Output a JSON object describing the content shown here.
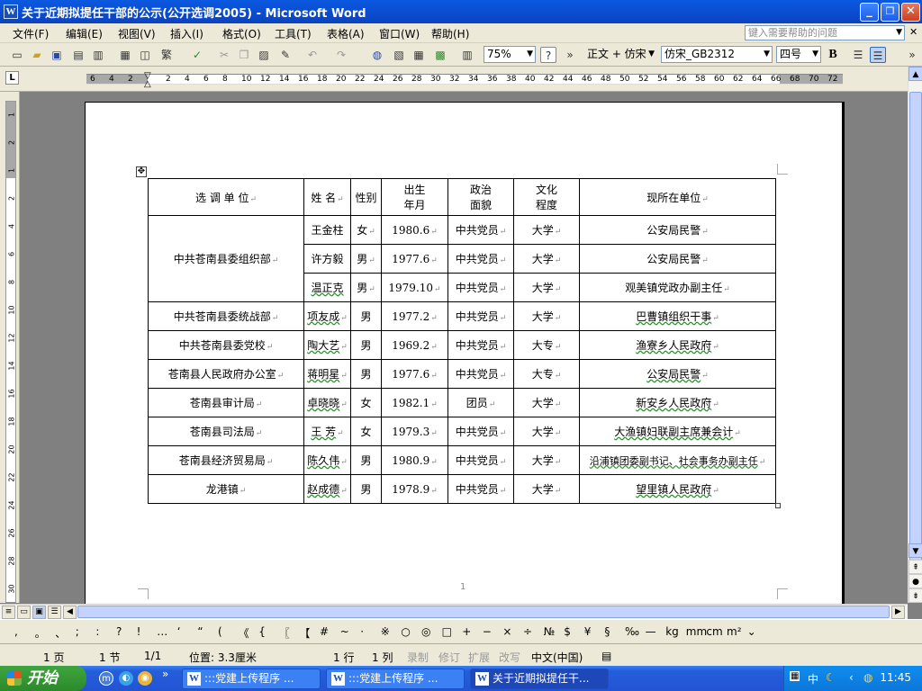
{
  "window": {
    "title": "关于近期拟提任干部的公示(公开选调2005) - Microsoft Word",
    "app_icon_letter": "W",
    "min_glyph": "_",
    "max_glyph": "❐",
    "close_glyph": "✕"
  },
  "menu": {
    "items": [
      "文件(F)",
      "编辑(E)",
      "视图(V)",
      "插入(I)",
      "格式(O)",
      "工具(T)",
      "表格(A)",
      "窗口(W)",
      "帮助(H)"
    ],
    "help_placeholder": "键入需要帮助的问题",
    "close_doc": "✕"
  },
  "toolbar": {
    "zoom": "75%",
    "style": "正文 + 仿宋",
    "font": "仿宋_GB2312",
    "size": "四号",
    "bold": "B",
    "trad_glyph": "繁"
  },
  "ruler": {
    "tab_selector": "L",
    "h_numbers": [
      "6",
      "4",
      "2",
      "",
      "2",
      "4",
      "6",
      "8",
      "10",
      "12",
      "14",
      "16",
      "18",
      "20",
      "22",
      "24",
      "26",
      "28",
      "30",
      "32",
      "34",
      "36",
      "38",
      "40",
      "42",
      "44",
      "46",
      "48",
      "50",
      "52",
      "54",
      "56",
      "58",
      "60",
      "62",
      "64",
      "66",
      "68",
      "70",
      "72"
    ],
    "v_numbers": [
      "1",
      "2",
      "1",
      "2",
      "4",
      "6",
      "8",
      "10",
      "12",
      "14",
      "16",
      "18",
      "20",
      "22",
      "24",
      "26",
      "28",
      "30"
    ]
  },
  "table": {
    "headers": [
      "选 调 单 位",
      "姓 名",
      "性别",
      "出生\n年月",
      "政治\n面貌",
      "文化\n程度",
      "现所在单位"
    ],
    "group1_unit": "中共苍南县委组织部",
    "group1_rows": [
      [
        "王金柱",
        "女",
        "1980.6",
        "中共党员",
        "大学",
        "公安局民警"
      ],
      [
        "许方毅",
        "男",
        "1977.6",
        "中共党员",
        "大学",
        "公安局民警"
      ],
      [
        "温正克",
        "男",
        "1979.10",
        "中共党员",
        "大学",
        "观美镇党政办副主任"
      ]
    ],
    "rows": [
      [
        "中共苍南县委统战部",
        "项友成",
        "男",
        "1977.2",
        "中共党员",
        "大学",
        "巴曹镇组织干事"
      ],
      [
        "中共苍南县委党校",
        "陶大艺",
        "男",
        "1969.2",
        "中共党员",
        "大专",
        "渔寮乡人民政府"
      ],
      [
        "苍南县人民政府办公室",
        "蒋明星",
        "男",
        "1977.6",
        "中共党员",
        "大专",
        "公安局民警"
      ],
      [
        "苍南县审计局",
        "卓晓晓",
        "女",
        "1982.1",
        "团员",
        "大学",
        "新安乡人民政府"
      ],
      [
        "苍南县司法局",
        "王 芳",
        "女",
        "1979.3",
        "中共党员",
        "大学",
        "大渔镇妇联副主席兼会计"
      ],
      [
        "苍南县经济贸易局",
        "陈久伟",
        "男",
        "1980.9",
        "中共党员",
        "大学",
        "沿浦镇团委副书记、社会事务办副主任"
      ],
      [
        "龙港镇",
        "赵成德",
        "男",
        "1978.9",
        "中共党员",
        "大学",
        "望里镇人民政府"
      ]
    ],
    "para_mark": "↵",
    "move_handle": "✥",
    "page_number": "1"
  },
  "symbols": [
    ",",
    "。",
    "、",
    ";",
    ":",
    "?",
    "!",
    "…",
    "‘",
    "“",
    "(",
    "《",
    "{",
    "〖",
    "【",
    "#",
    "~",
    "·",
    "※",
    "○",
    "◎",
    "□",
    "+",
    "−",
    "×",
    "÷",
    "№",
    "$",
    "¥",
    "§",
    "‰",
    "—",
    "kg",
    "mm",
    "cm",
    "m²",
    "⌄"
  ],
  "status": {
    "page": "1 页",
    "section": "1 节",
    "page_of": "1/1",
    "position": "位置: 3.3厘米",
    "line": "1 行",
    "col": "1 列",
    "rec": "录制",
    "trk": "修订",
    "ext": "扩展",
    "ovr": "改写",
    "lang": "中文(中国)"
  },
  "taskbar": {
    "start": "开始",
    "tasks": [
      ":::党建上传程序 ...",
      ":::党建上传程序 ...",
      "关于近期拟提任干..."
    ],
    "ime": "中",
    "clock": "11:45"
  },
  "colors": {
    "titlebar": "#0b4fd4",
    "chrome": "#ece9d8",
    "workspace": "#808080",
    "taskbar": "#245edb",
    "start": "#2b8a2b"
  }
}
